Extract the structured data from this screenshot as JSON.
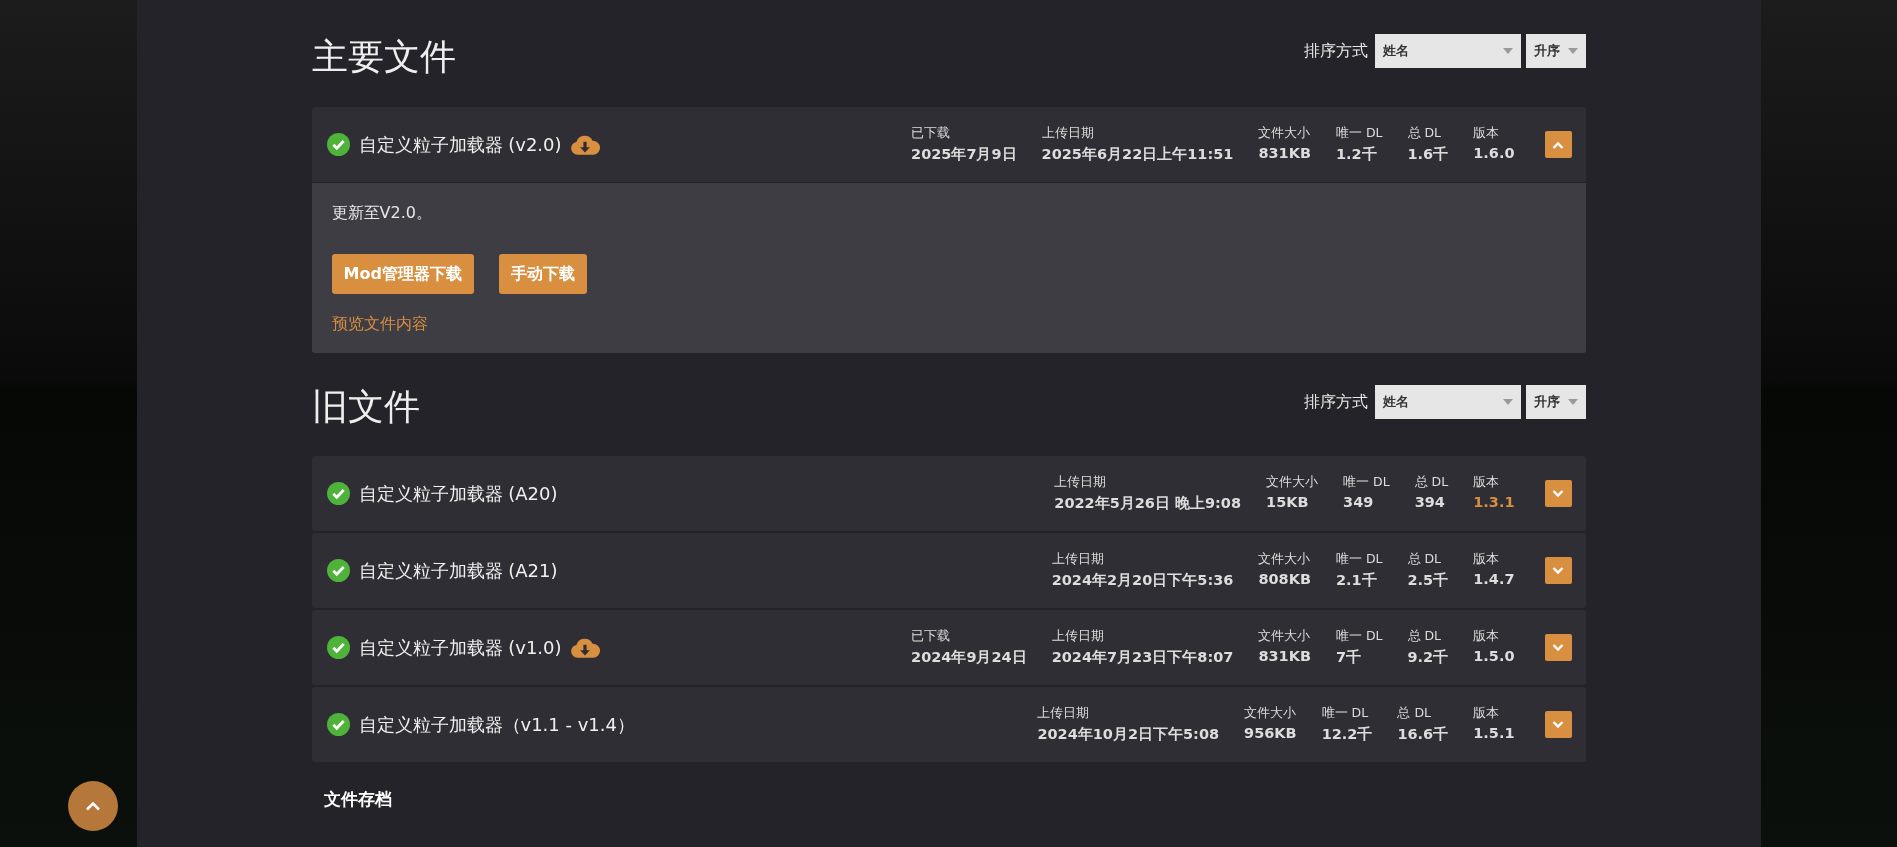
{
  "sections": [
    {
      "title": "主要文件",
      "sort_label": "排序方式",
      "sort_value": "姓名",
      "order": "升序",
      "files": [
        {
          "name": "自定义粒子加载器 (v2.0)",
          "verified": true,
          "downloaded": true,
          "expanded": true,
          "stats": [
            {
              "label": "已下载",
              "value": "2025年7月9日",
              "highlight": false
            },
            {
              "label": "上传日期",
              "value": "2025年6月22日上午11:51",
              "highlight": false
            },
            {
              "label": "文件大小",
              "value": "831KB",
              "highlight": false
            },
            {
              "label": "唯一 DL",
              "value": "1.2千",
              "highlight": false
            },
            {
              "label": "总 DL",
              "value": "1.6千",
              "highlight": false
            },
            {
              "label": "版本",
              "value": "1.6.0",
              "highlight": false
            }
          ],
          "description": "更新至V2.0。",
          "buttons": [
            "Mod管理器下载",
            "手动下载"
          ],
          "preview_link": "预览文件内容"
        }
      ]
    },
    {
      "title": "旧文件",
      "sort_label": "排序方式",
      "sort_value": "姓名",
      "order": "升序",
      "files": [
        {
          "name": "自定义粒子加载器 (A20)",
          "verified": true,
          "downloaded": false,
          "expanded": false,
          "stats": [
            {
              "label": "上传日期",
              "value": "2022年5月26日 晚上9:08",
              "highlight": false
            },
            {
              "label": "文件大小",
              "value": "15KB",
              "highlight": false
            },
            {
              "label": "唯一 DL",
              "value": "349",
              "highlight": false
            },
            {
              "label": "总 DL",
              "value": "394",
              "highlight": false
            },
            {
              "label": "版本",
              "value": "1.3.1",
              "highlight": true
            }
          ]
        },
        {
          "name": "自定义粒子加载器 (A21)",
          "verified": true,
          "downloaded": false,
          "expanded": false,
          "stats": [
            {
              "label": "上传日期",
              "value": "2024年2月20日下午5:36",
              "highlight": false
            },
            {
              "label": "文件大小",
              "value": "808KB",
              "highlight": false
            },
            {
              "label": "唯一 DL",
              "value": "2.1千",
              "highlight": false
            },
            {
              "label": "总 DL",
              "value": "2.5千",
              "highlight": false
            },
            {
              "label": "版本",
              "value": "1.4.7",
              "highlight": false
            }
          ]
        },
        {
          "name": "自定义粒子加载器 (v1.0)",
          "verified": true,
          "downloaded": true,
          "expanded": false,
          "stats": [
            {
              "label": "已下载",
              "value": "2024年9月24日",
              "highlight": false
            },
            {
              "label": "上传日期",
              "value": "2024年7月23日下午8:07",
              "highlight": false
            },
            {
              "label": "文件大小",
              "value": "831KB",
              "highlight": false
            },
            {
              "label": "唯一 DL",
              "value": "7千",
              "highlight": false
            },
            {
              "label": "总 DL",
              "value": "9.2千",
              "highlight": false
            },
            {
              "label": "版本",
              "value": "1.5.0",
              "highlight": false
            }
          ]
        },
        {
          "name": "自定义粒子加载器（v1.1 - v1.4）",
          "verified": true,
          "downloaded": false,
          "expanded": false,
          "stats": [
            {
              "label": "上传日期",
              "value": "2024年10月2日下午5:08",
              "highlight": false
            },
            {
              "label": "文件大小",
              "value": "956KB",
              "highlight": false
            },
            {
              "label": "唯一 DL",
              "value": "12.2千",
              "highlight": false
            },
            {
              "label": "总 DL",
              "value": "16.6千",
              "highlight": false
            },
            {
              "label": "版本",
              "value": "1.5.1",
              "highlight": false
            }
          ]
        }
      ]
    }
  ],
  "archive_title": "文件存档"
}
